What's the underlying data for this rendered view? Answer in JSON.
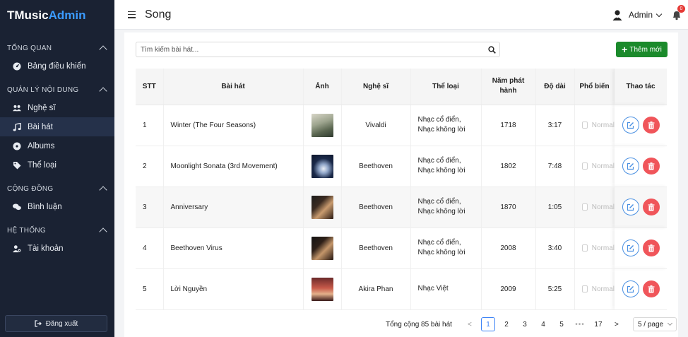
{
  "brand": {
    "part1": "TMusic",
    "part2": "Admin"
  },
  "sidebar": {
    "sections": [
      {
        "title": "TỔNG QUAN",
        "items": [
          {
            "label": "Bảng điều khiển",
            "icon": "dashboard-icon"
          }
        ]
      },
      {
        "title": "QUẢN LÝ NỘI DUNG",
        "items": [
          {
            "label": "Nghệ sĩ",
            "icon": "users-icon"
          },
          {
            "label": "Bài hát",
            "icon": "music-note-icon",
            "active": true
          },
          {
            "label": "Albums",
            "icon": "disc-icon"
          },
          {
            "label": "Thể loại",
            "icon": "tag-icon"
          }
        ]
      },
      {
        "title": "CỘNG ĐỒNG",
        "items": [
          {
            "label": "Bình luận",
            "icon": "comments-icon"
          }
        ]
      },
      {
        "title": "HỆ THỐNG",
        "items": [
          {
            "label": "Tài khoản",
            "icon": "user-cog-icon"
          }
        ]
      }
    ],
    "logout_label": "Đăng xuất"
  },
  "header": {
    "title": "Song",
    "user_name": "Admin",
    "notification_count": "0"
  },
  "search": {
    "placeholder": "Tìm kiếm bài hát..."
  },
  "add_button_label": "Thêm mới",
  "table": {
    "columns": [
      "STT",
      "Bài hát",
      "Ảnh",
      "Nghệ sĩ",
      "Thể loại",
      "Năm phát hành",
      "Độ dài",
      "Phổ biến",
      "Thao tác"
    ],
    "rows": [
      {
        "stt": "1",
        "song": "Winter (The Four Seasons)",
        "artist": "Vivaldi",
        "genre1": "Nhạc cổ điển,",
        "genre2": "Nhạc không lời",
        "year": "1718",
        "duration": "3:17",
        "popular": "Normal"
      },
      {
        "stt": "2",
        "song": "Moonlight Sonata (3rd Movement)",
        "artist": "Beethoven",
        "genre1": "Nhạc cổ điển,",
        "genre2": "Nhạc không lời",
        "year": "1802",
        "duration": "7:48",
        "popular": "Normal"
      },
      {
        "stt": "3",
        "song": "Anniversary",
        "artist": "Beethoven",
        "genre1": "Nhạc cổ điển,",
        "genre2": "Nhạc không lời",
        "year": "1870",
        "duration": "1:05",
        "popular": "Normal"
      },
      {
        "stt": "4",
        "song": "Beethoven Virus",
        "artist": "Beethoven",
        "genre1": "Nhạc cổ điển,",
        "genre2": "Nhạc không lời",
        "year": "2008",
        "duration": "3:40",
        "popular": "Normal"
      },
      {
        "stt": "5",
        "song": "Lời Nguyền",
        "artist": "Akira Phan",
        "genre1": "Nhạc Việt",
        "genre2": "",
        "year": "2009",
        "duration": "5:25",
        "popular": "Normal"
      }
    ]
  },
  "pagination": {
    "total_text": "Tổng cộng 85 bài hát",
    "prev": "<",
    "next": ">",
    "pages": [
      "1",
      "2",
      "3",
      "4",
      "5"
    ],
    "dots": "•••",
    "last": "17",
    "current": "1",
    "page_size": "5 / page"
  },
  "colors": {
    "sidebar_bg": "#1a2233",
    "brand_accent": "#3b9bff",
    "add_button": "#1b8a2b",
    "delete_button": "#f0555a",
    "edit_border": "#4a90e2"
  }
}
